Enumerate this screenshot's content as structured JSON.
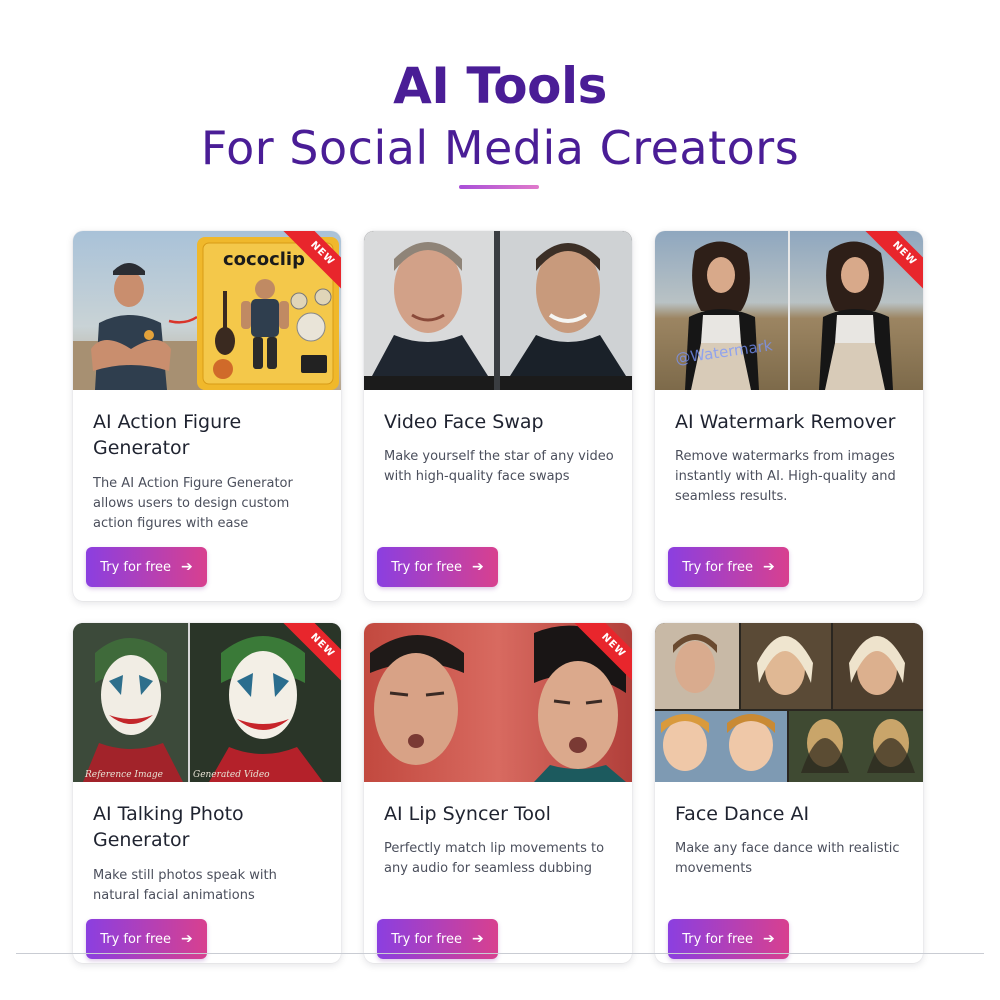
{
  "hero": {
    "title": "AI Tools",
    "subtitle": "For Social Media Creators"
  },
  "badge_text": "NEW",
  "button_icon": "arrow-right-icon",
  "cards": [
    {
      "title": "AI Action Figure Generator",
      "description": "The AI Action Figure Generator allows users to design custom action figures with ease",
      "button": "Try for free",
      "is_new": true,
      "image_brand_text": "cococlip"
    },
    {
      "title": "Video Face Swap",
      "description": "Make yourself the star of any video with high-quality face swaps",
      "button": "Try for free",
      "is_new": false
    },
    {
      "title": "AI Watermark Remover",
      "description": "Remove watermarks from images instantly with AI. High-quality and seamless results.",
      "button": "Try for free",
      "is_new": true,
      "image_watermark_text": "@Watermark"
    },
    {
      "title": "AI Talking Photo Generator",
      "description": "Make still photos speak with natural facial animations",
      "button": "Try for free",
      "is_new": true,
      "image_captions": [
        "Reference Image",
        "Generated Video"
      ]
    },
    {
      "title": "AI Lip Syncer Tool",
      "description": "Perfectly match lip movements to any audio for seamless dubbing",
      "button": "Try for free",
      "is_new": true
    },
    {
      "title": "Face Dance AI",
      "description": "Make any face dance with realistic movements",
      "button": "Try for free",
      "is_new": false
    }
  ],
  "colors": {
    "heading": "#4a1d96",
    "button_gradient_start": "#8b3fe0",
    "button_gradient_end": "#d8408f",
    "badge": "#e8262c"
  }
}
